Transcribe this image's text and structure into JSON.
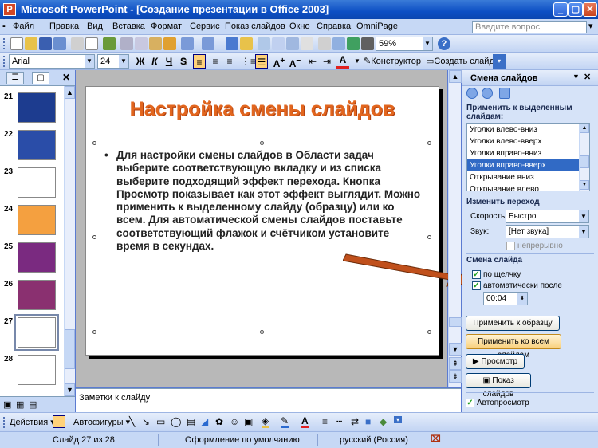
{
  "window": {
    "title": "Microsoft PowerPoint - [Создание презентации в Office 2003]",
    "app_icon": "P"
  },
  "menu": [
    "Файл",
    "Правка",
    "Вид",
    "Вставка",
    "Формат",
    "Сервис",
    "Показ слайдов",
    "Окно",
    "Справка",
    "OmniPage"
  ],
  "ask": {
    "placeholder": "Введите вопрос"
  },
  "standard_toolbar": {
    "zoom": "59%"
  },
  "formatting_toolbar": {
    "font": "Arial",
    "size": "24",
    "bold": "Ж",
    "italic": "К",
    "underline": "Ч",
    "shadow": "S",
    "constructor_label": "Конструктор",
    "new_slide_label": "Создать слайд"
  },
  "slides_pane": {
    "tab_outline": "☰",
    "tab_slides": "▢",
    "close": "✕",
    "thumbnails": [
      {
        "num": "21",
        "bg": "#1d3c8f"
      },
      {
        "num": "22",
        "bg": "#2a4da8"
      },
      {
        "num": "23",
        "bg": "#ffffff"
      },
      {
        "num": "24",
        "bg": "#f4a040"
      },
      {
        "num": "25",
        "bg": "#7a2a80"
      },
      {
        "num": "26",
        "bg": "#8a3070"
      },
      {
        "num": "27",
        "bg": "#ffffff",
        "selected": true
      },
      {
        "num": "28",
        "bg": "#ffffff"
      }
    ]
  },
  "slide": {
    "title": "Настройка смены слайдов",
    "body": "Для настройки смены слайдов в Области задач выберите соответствующую вкладку и из списка выберите подходящий эффект перехода. Кнопка Просмотр показывает как этот эффект выглядит. Можно применить к выделенному слайду (образцу) или ко всем. Для автоматической смены слайдов поставьте соответствующий флажок и счётчиком установите время в секундах."
  },
  "notes": {
    "text": "Заметки к слайду"
  },
  "task_pane": {
    "title": "Смена слайдов",
    "apply_label": "Применить к выделенным слайдам:",
    "transitions": [
      "Уголки влево-вниз",
      "Уголки влево-вверх",
      "Уголки вправо-вниз",
      "Уголки вправо-вверх",
      "Открывание вниз",
      "Открывание влево"
    ],
    "selected_transition": "Уголки вправо-вверх",
    "change_label": "Изменить переход",
    "speed_label": "Скорость:",
    "speed_value": "Быстро",
    "sound_label": "Звук:",
    "sound_value": "[Нет звука]",
    "loop_label": "непрерывно",
    "advance_label": "Смена слайда",
    "on_click_label": "по щелчку",
    "auto_label": "автоматически после",
    "time_value": "00:04",
    "apply_master_button": "Применить к образцу",
    "apply_all_button": "Применить ко всем слайдам",
    "preview_button": "Просмотр",
    "slideshow_button": "Показ слайдов",
    "autopreview_label": "Автопросмотр"
  },
  "drawing_toolbar": {
    "actions_label": "Действия",
    "autoshapes_label": "Автофигуры"
  },
  "status": {
    "slide": "Слайд 27 из 28",
    "design": "Оформление по умолчанию",
    "language": "русский (Россия)"
  }
}
